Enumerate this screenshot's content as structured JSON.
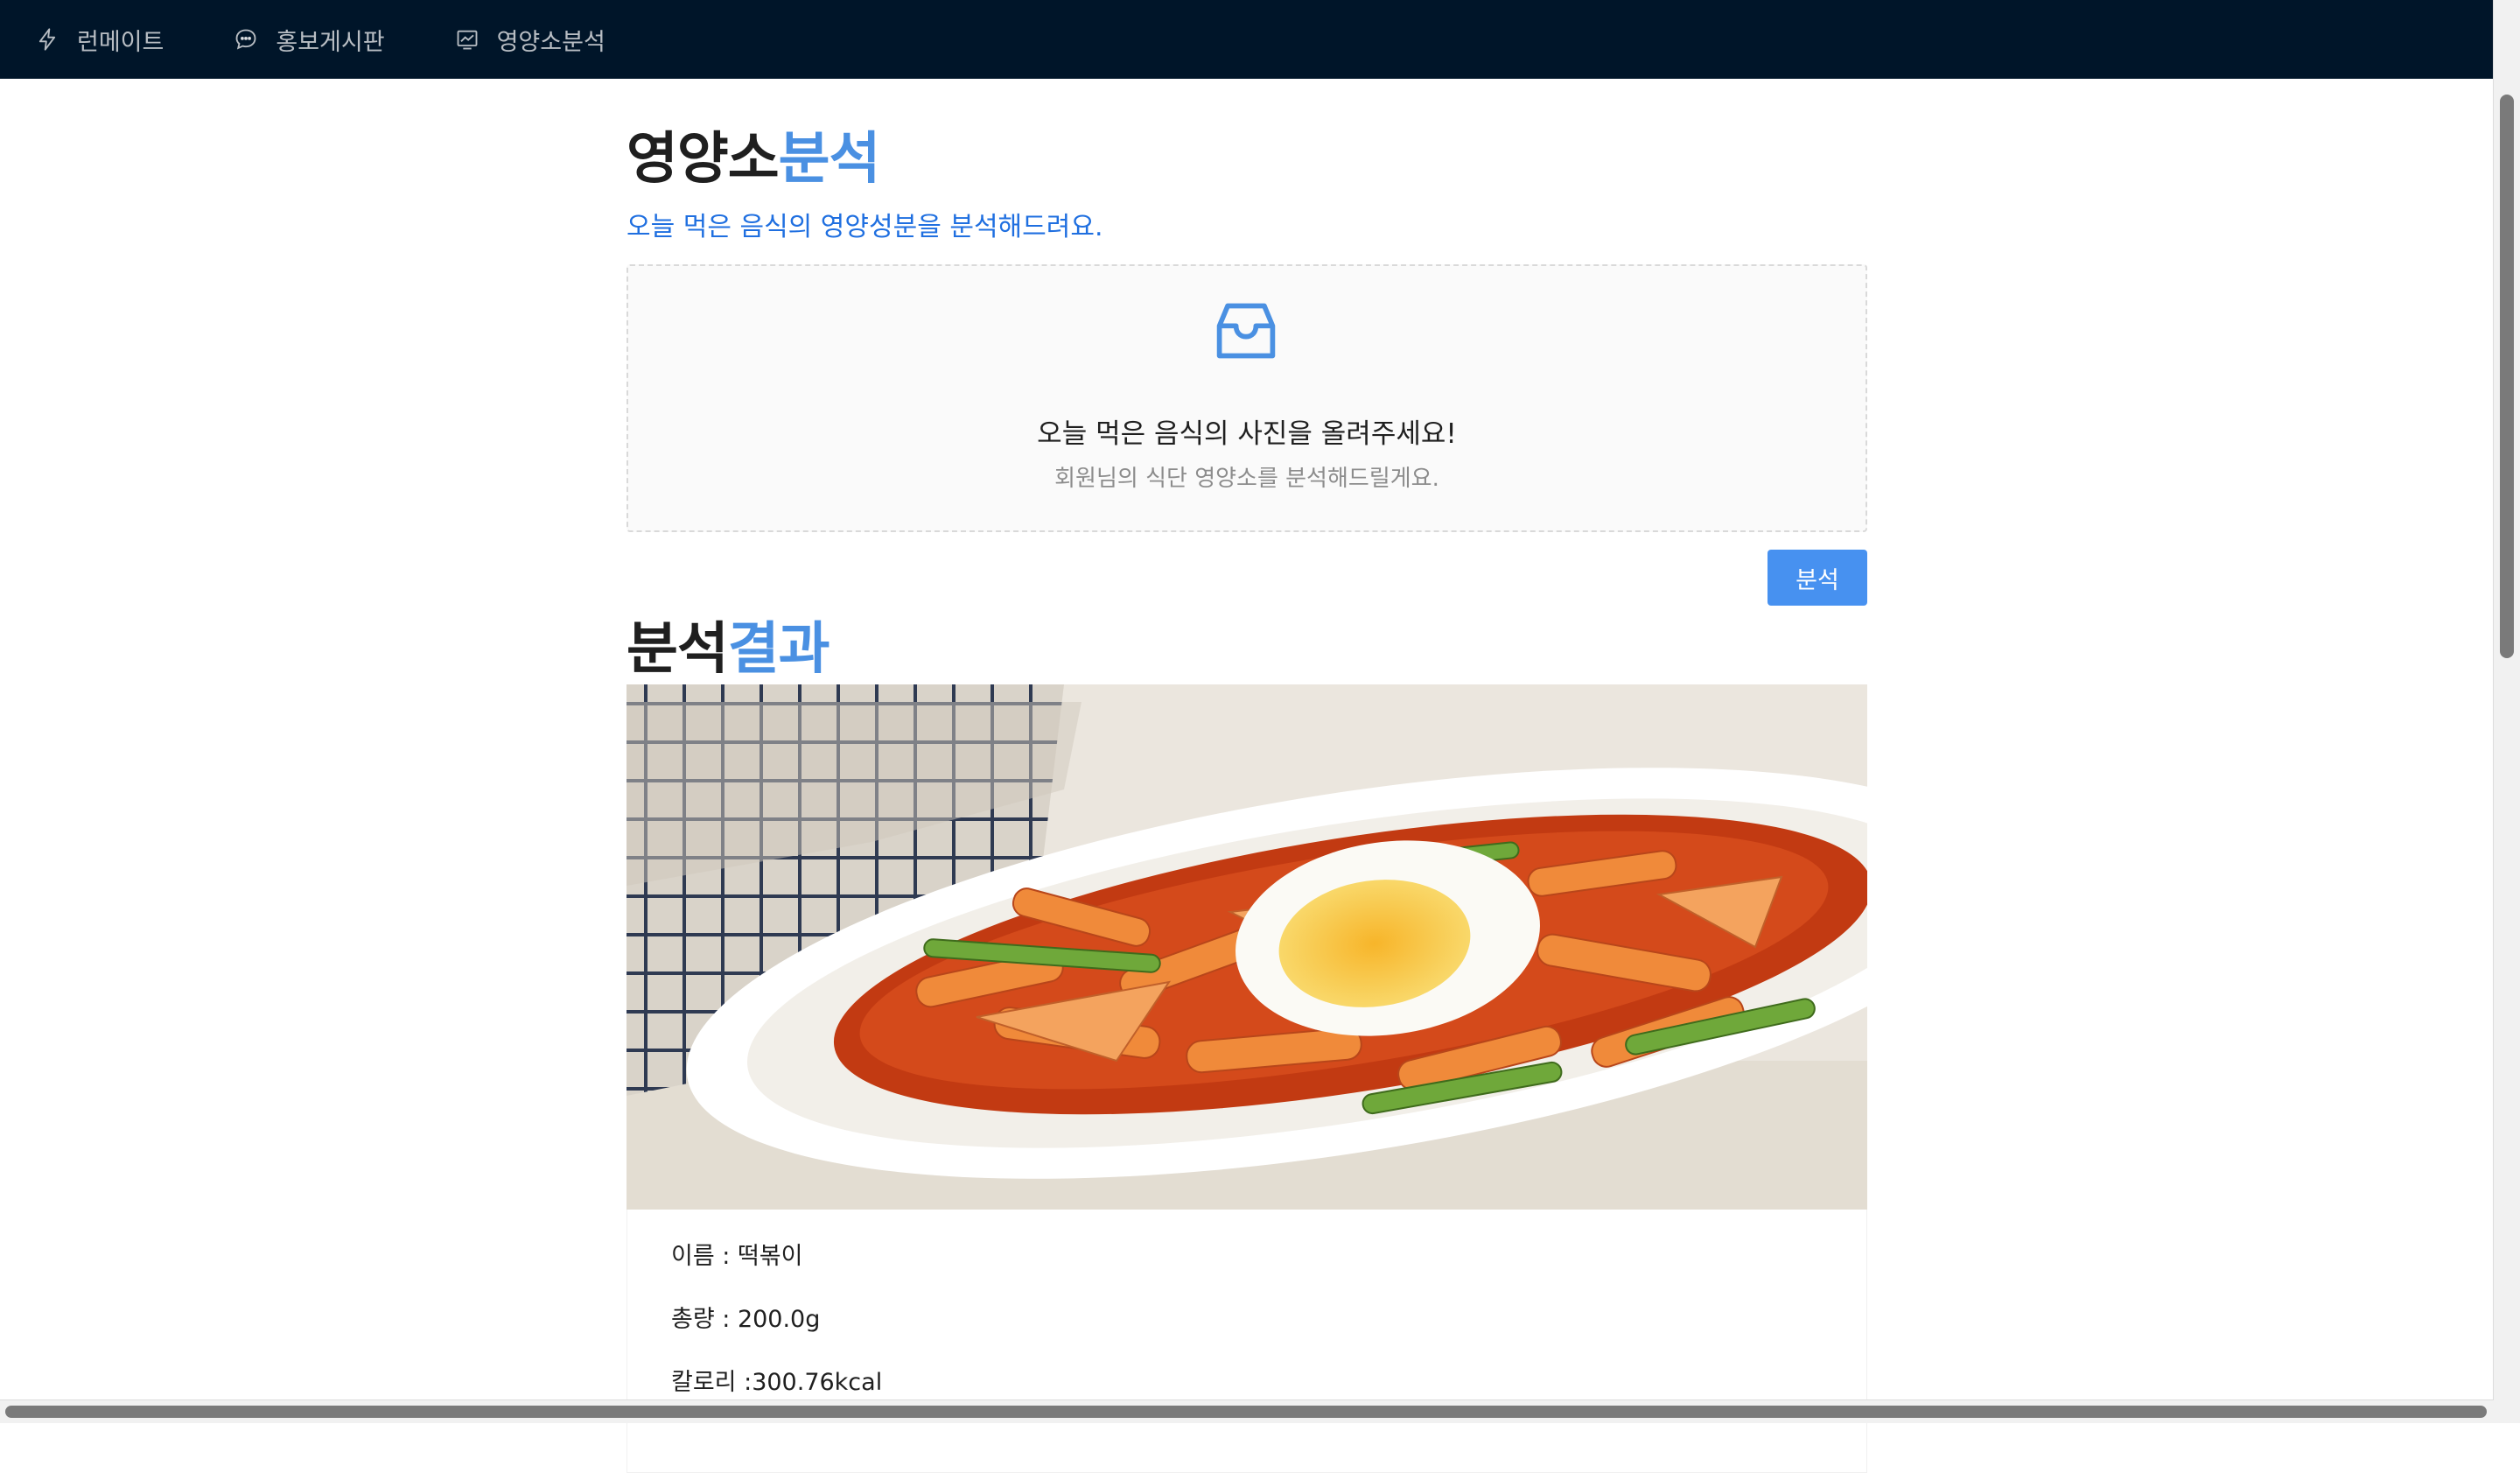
{
  "nav": {
    "items": [
      {
        "label": "런메이트",
        "icon": "lightning-icon"
      },
      {
        "label": "홍보게시판",
        "icon": "chat-bubble-icon"
      },
      {
        "label": "영양소분석",
        "icon": "fund-chart-icon"
      }
    ]
  },
  "page": {
    "title_dark": "영양소",
    "title_blue": "분석",
    "subtitle": "오늘 먹은 음식의 영양성분을 분석해드려요."
  },
  "upload": {
    "icon": "inbox-icon",
    "text": "오늘 먹은 음식의 사진을 올려주세요!",
    "hint": "회원님의 식단 영양소를 분석해드릴게요."
  },
  "analyze_button": "분석",
  "result": {
    "title_dark": "분석",
    "title_blue": "결과",
    "image": "tteokbokki-photo",
    "lines": [
      "이름 : 떡볶이",
      "총량 : 200.0g",
      "칼로리 :300.76kcal"
    ]
  },
  "colors": {
    "nav_bg": "#001529",
    "accent_blue": "#4a90e2",
    "button_blue": "#4791f0"
  }
}
